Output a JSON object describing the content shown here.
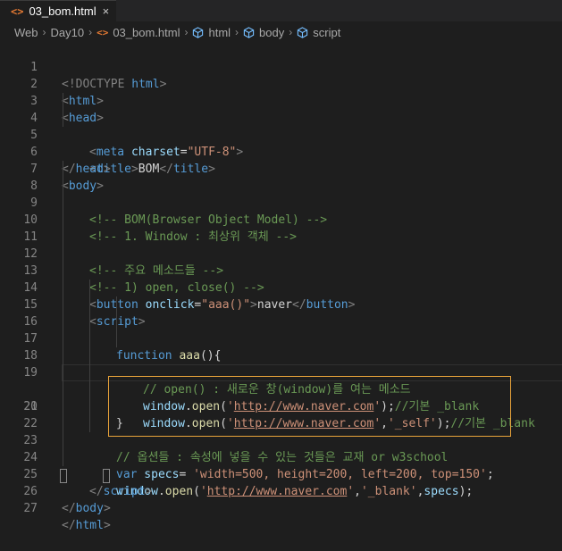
{
  "tab": {
    "icon": "<>",
    "filename": "03_bom.html",
    "close": "×"
  },
  "breadcrumb": {
    "items": [
      "Web",
      "Day10",
      "03_bom.html",
      "html",
      "body",
      "script"
    ],
    "separator": "›"
  },
  "colors": {
    "highlight_border": "#e8a33a",
    "file_icon": "#e37933"
  },
  "line_numbers": [
    "1",
    "2",
    "3",
    "4",
    "5",
    "6",
    "7",
    "8",
    "9",
    "10",
    "11",
    "12",
    "13",
    "14",
    "15",
    "16",
    "17",
    "18",
    "19",
    "20",
    "21",
    "22",
    "23",
    "24",
    "25",
    "26",
    "27"
  ],
  "code": {
    "l1": [
      "<!DOCTYPE",
      " html",
      ">"
    ],
    "l2": [
      "<",
      "html",
      ">"
    ],
    "l3": [
      "<",
      "head",
      ">"
    ],
    "l4": [
      "<",
      "meta",
      " charset",
      "=",
      "\"UTF-8\"",
      ">"
    ],
    "l5": [
      "<",
      "title",
      ">",
      "BOM",
      "</",
      "title",
      ">"
    ],
    "l6": [
      "</",
      "head",
      ">"
    ],
    "l7": [
      "<",
      "body",
      ">"
    ],
    "l8": "<!-- BOM(Browser Object Model) -->",
    "l9": "<!-- 1. Window : 최상위 객체 -->",
    "l11": "<!-- 주요 메소드들 -->",
    "l12": "<!-- 1) open, close() -->",
    "l13": [
      "<",
      "button",
      " onclick",
      "=",
      "\"aaa()\"",
      ">",
      "naver",
      "</",
      "button",
      ">"
    ],
    "l14": [
      "<",
      "script",
      ">"
    ],
    "l15": [
      "function",
      " aaa",
      "(){"
    ],
    "l16": "// open() : 새로운 창(window)를 여는 메소드",
    "l17": [
      "window",
      ".",
      "open",
      "(",
      "'",
      "http://www.naver.com",
      "'",
      ");",
      "//기본 _blank"
    ],
    "l18": [
      "window",
      ".",
      "open",
      "(",
      "'",
      "http://www.naver.com",
      "'",
      ",",
      "'_self'",
      ");",
      "//기본 _blank"
    ],
    "l19": "}",
    "l21": "// 옵션들 : 속성에 넣을 수 있는 것들은 교재 or w3school",
    "l22": [
      "var",
      " specs",
      "= ",
      "'width=500, height=200, left=200, top=150'",
      ";"
    ],
    "l23": [
      "window",
      ".",
      "open",
      "(",
      "'",
      "http://www.naver.com",
      "'",
      ",",
      "'_blank'",
      ",",
      "specs",
      ");"
    ],
    "l24": [
      "</",
      "script",
      ">"
    ],
    "l26": [
      "</",
      "body",
      ">"
    ],
    "l27": [
      "</",
      "html",
      ">"
    ]
  }
}
